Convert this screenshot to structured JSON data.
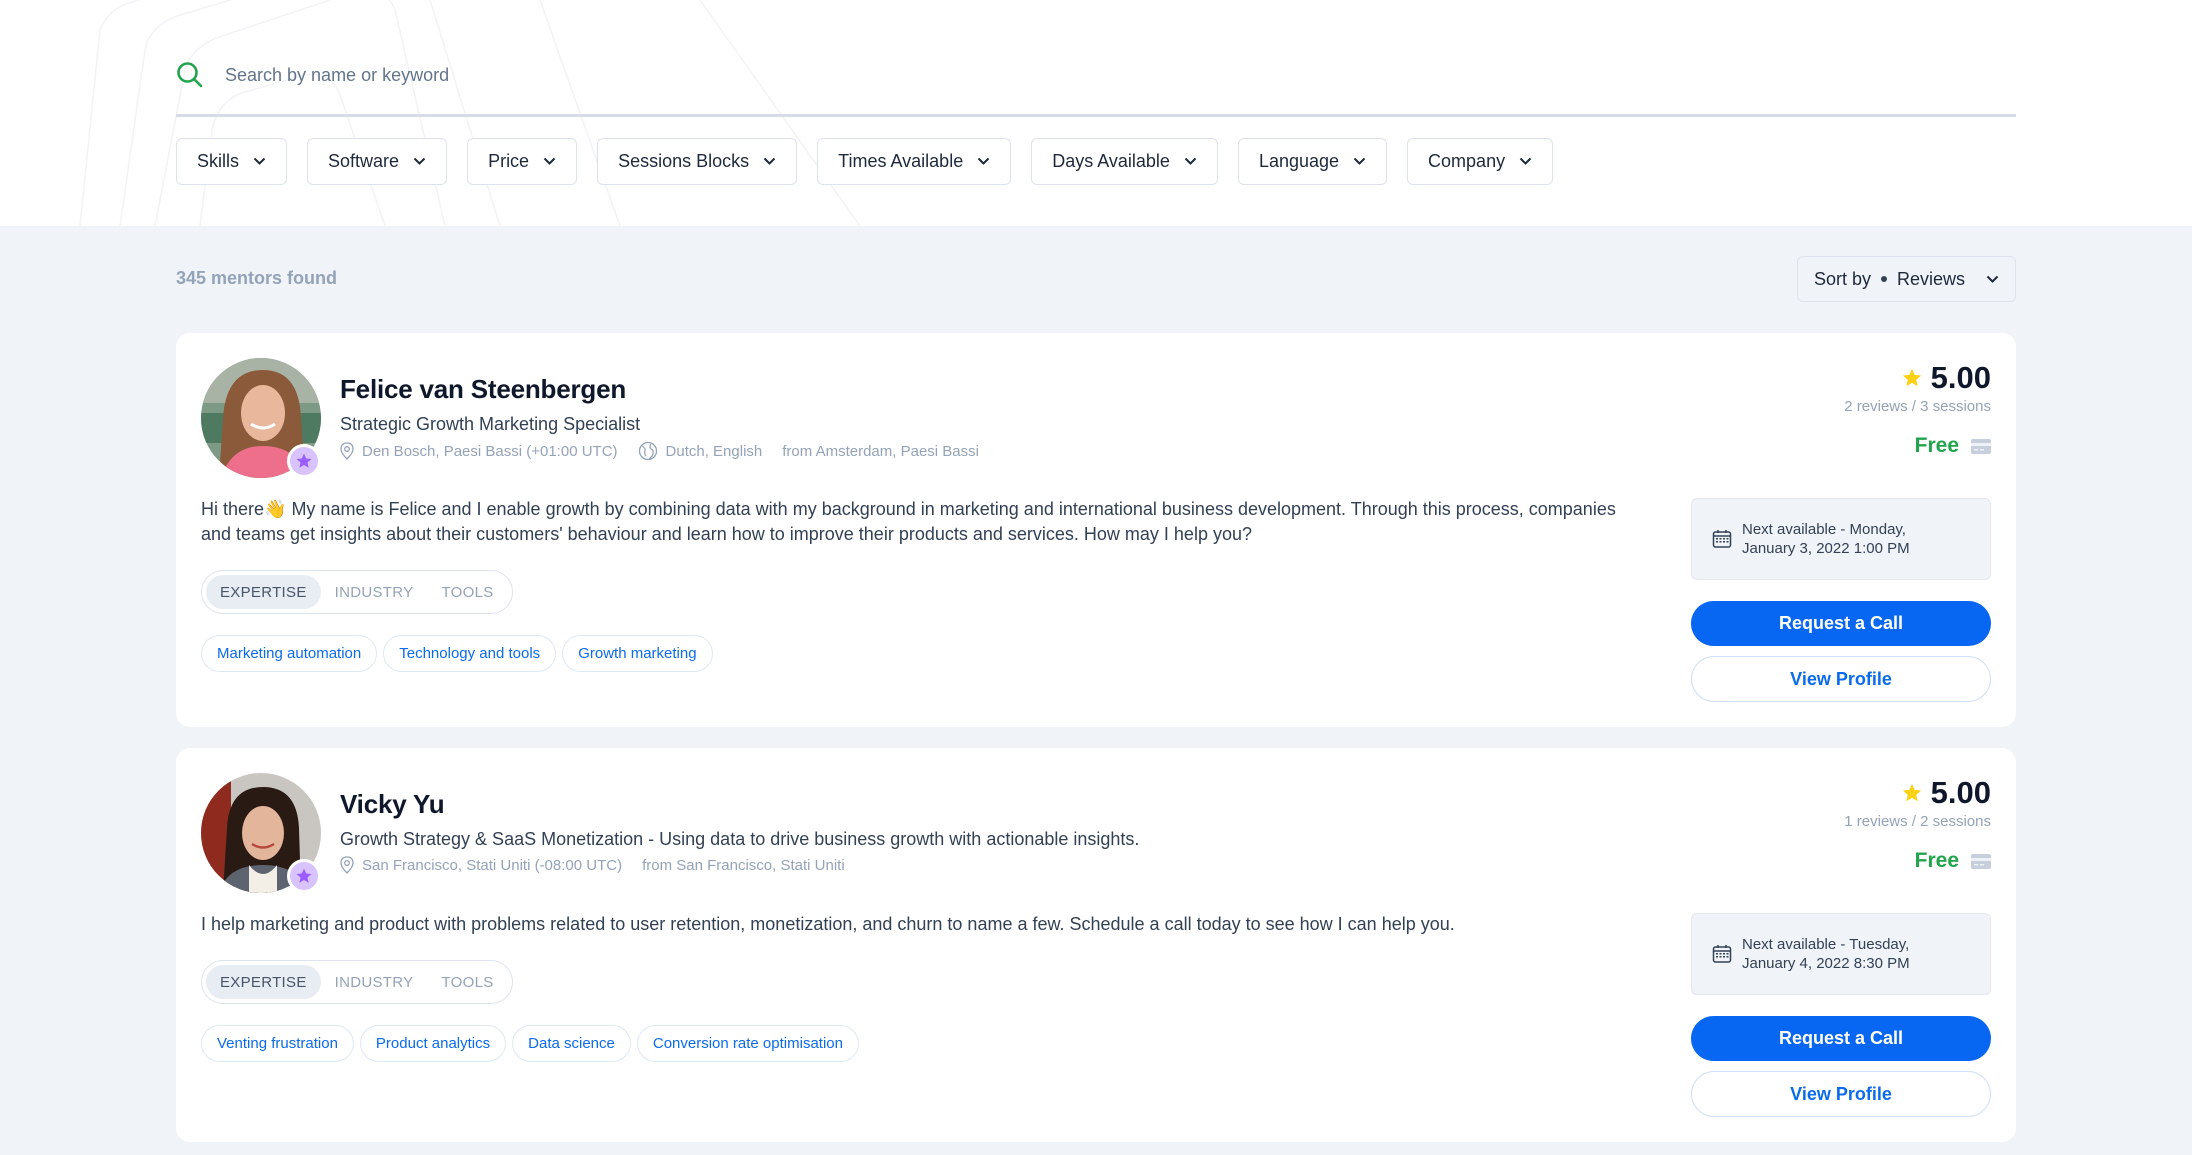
{
  "search": {
    "placeholder": "Search by name or keyword",
    "icon": "search-icon",
    "accent_color": "#22a44d"
  },
  "filters": [
    {
      "label": "Skills"
    },
    {
      "label": "Software"
    },
    {
      "label": "Price"
    },
    {
      "label": "Sessions Blocks"
    },
    {
      "label": "Times Available"
    },
    {
      "label": "Days Available"
    },
    {
      "label": "Language"
    },
    {
      "label": "Company"
    }
  ],
  "results": {
    "count_text": "345 mentors found",
    "sort_label": "Sort by",
    "sort_value": "Reviews"
  },
  "mentors": [
    {
      "name": "Felice van Steenbergen",
      "title": "Strategic Growth Marketing Specialist",
      "location": "Den Bosch, Paesi Bassi (+01:00 UTC)",
      "languages": "Dutch, English",
      "from": "from Amsterdam, Paesi Bassi",
      "bio": "Hi there👋 My name is Felice and I enable growth by combining data with my background in marketing and international business development. Through this process, companies and teams get insights about their customers' behaviour and learn how to improve their products and services. How may I help you?",
      "tabs": [
        "EXPERTISE",
        "INDUSTRY",
        "TOOLS"
      ],
      "active_tab": "EXPERTISE",
      "tags": [
        "Marketing automation",
        "Technology and tools",
        "Growth marketing"
      ],
      "rating": "5.00",
      "reviews": "2 reviews / 3 sessions",
      "price": "Free",
      "next_available_line1": "Next available - Monday,",
      "next_available_line2": "January 3, 2022 1:00 PM",
      "request_label": "Request a Call",
      "profile_label": "View Profile"
    },
    {
      "name": "Vicky Yu",
      "title": "Growth Strategy & SaaS Monetization - Using data to drive business growth with actionable insights.",
      "location": "San Francisco, Stati Uniti (-08:00 UTC)",
      "languages": "",
      "from": "from San Francisco, Stati Uniti",
      "bio": "I help marketing and product with problems related to user retention, monetization, and churn to name a few. Schedule a call today to see how I can help you.",
      "tabs": [
        "EXPERTISE",
        "INDUSTRY",
        "TOOLS"
      ],
      "active_tab": "EXPERTISE",
      "tags": [
        "Venting frustration",
        "Product analytics",
        "Data science",
        "Conversion rate optimisation"
      ],
      "rating": "5.00",
      "reviews": "1 reviews / 2 sessions",
      "price": "Free",
      "next_available_line1": "Next available - Tuesday,",
      "next_available_line2": "January 4, 2022 8:30 PM",
      "request_label": "Request a Call",
      "profile_label": "View Profile"
    }
  ],
  "colors": {
    "primary_blue": "#0867f2",
    "link_blue": "#0b6bea",
    "free_green": "#22a44d",
    "star_yellow": "#fcd116",
    "badge_purple": "#9a5cff",
    "page_bg": "#f0f3f8"
  }
}
